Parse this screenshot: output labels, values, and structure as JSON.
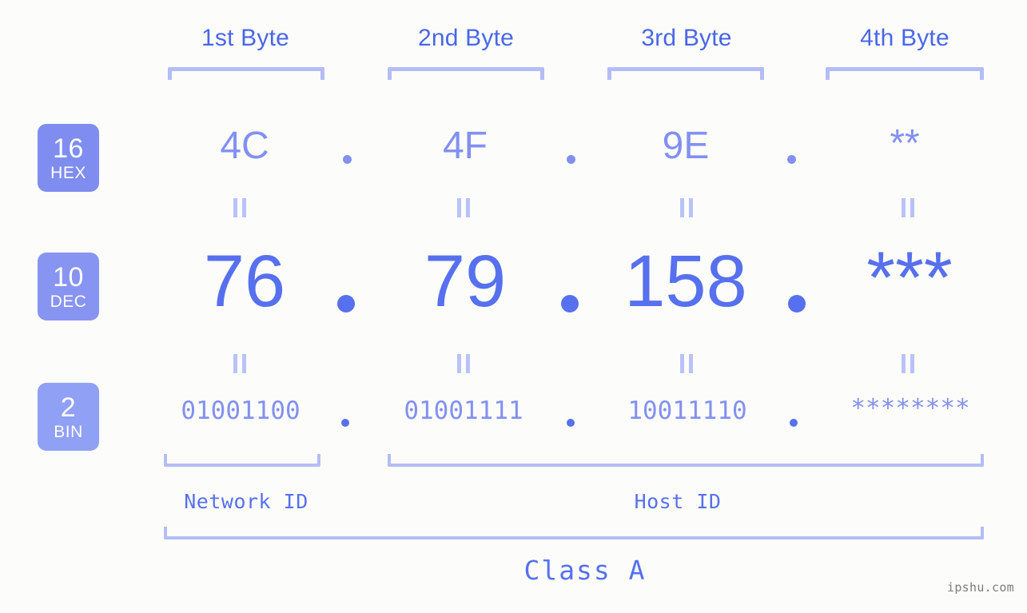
{
  "background_color": "#fcfdfa",
  "accent_color": "#5770ef",
  "accent_light_color": "#8290f2",
  "bracket_color": "#b4bdf7",
  "badge_color": "#7f8df0",
  "badge_color_light": "#8fa0f5",
  "headers": {
    "byte1": "1st Byte",
    "byte2": "2nd Byte",
    "byte3": "3rd Byte",
    "byte4": "4th Byte"
  },
  "bases": [
    {
      "number": "16",
      "abbr": "HEX"
    },
    {
      "number": "10",
      "abbr": "DEC"
    },
    {
      "number": "2",
      "abbr": "BIN"
    }
  ],
  "rows": {
    "hex": {
      "base_number": "16",
      "base_abbr": "HEX",
      "values": [
        "4C",
        "4F",
        "9E",
        "**"
      ],
      "separator": "."
    },
    "dec": {
      "base_number": "10",
      "base_abbr": "DEC",
      "values": [
        "76",
        "79",
        "158",
        "***"
      ],
      "separator": "."
    },
    "bin": {
      "base_number": "2",
      "base_abbr": "BIN",
      "values": [
        "01001100",
        "01001111",
        "10011110",
        "********"
      ],
      "separator": "."
    }
  },
  "equals_marks": {
    "symbol": "=",
    "count_per_gap": 4,
    "gaps": 2
  },
  "segments": {
    "network_id": "Network ID",
    "host_id": "Host ID"
  },
  "class_label": "Class A",
  "watermark": "ipshu.com"
}
